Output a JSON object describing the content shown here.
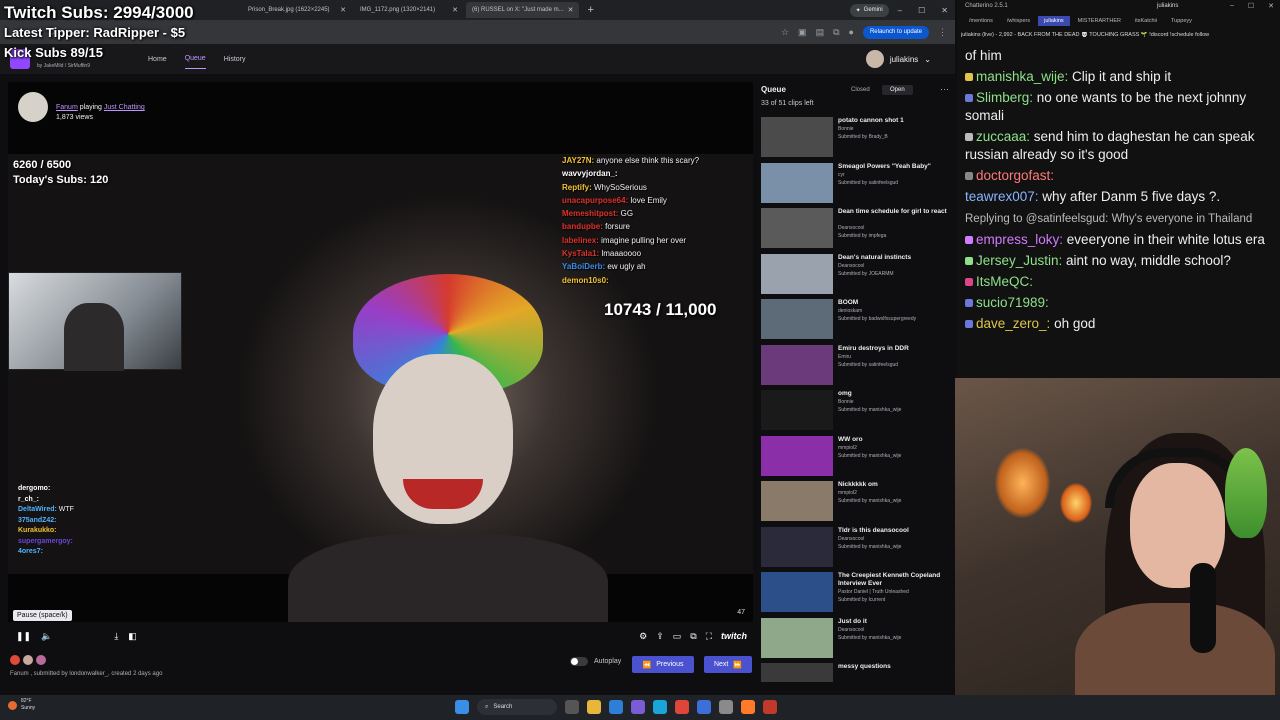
{
  "overlay": {
    "twitch_subs": "Twitch Subs: 2994/3000",
    "latest_tipper": "Latest Tipper: RadRipper - $5",
    "kick_subs": "Kick Subs 89/15"
  },
  "browser": {
    "tabs": [
      {
        "label": "Prison_Break.jpg (1622×2245)"
      },
      {
        "label": "IMG_1172.png (1320×2141)"
      },
      {
        "label": "(6) RUSSEL on X: \"Just made m..."
      }
    ],
    "new_tab": "+",
    "gemini": "Gemini",
    "relaunch": "Relaunch to update"
  },
  "site": {
    "byline_prefix": "by",
    "byline_users": "JakeMild / SirMuffin9",
    "nav": [
      "Home",
      "Queue",
      "History"
    ],
    "user": "juliakins"
  },
  "clip": {
    "channel": "Fanum",
    "playing": "playing",
    "category": "Just Chatting",
    "views": "1,873 views",
    "sub_goal": "6260 / 6500",
    "todays_subs": "Today's Subs: 120",
    "big_goal": "10743 / 11,000",
    "tooltip": "Pause (space/k)",
    "time": "47",
    "progress": 0.22,
    "chat": [
      {
        "user": "JAY27N",
        "color": "#f1c232",
        "text": "anyone else think this scary?"
      },
      {
        "user": "wavvyjordan_",
        "color": "#ffffff",
        "text": ""
      },
      {
        "user": "Reptify",
        "color": "#f1c232",
        "text": "WhySoSerious"
      },
      {
        "user": "unacapurpose64",
        "color": "#e0312b",
        "text": "love Emily"
      },
      {
        "user": "Memeshitpost",
        "color": "#e0312b",
        "text": "GG"
      },
      {
        "user": "bandupbe",
        "color": "#e0312b",
        "text": "forsure"
      },
      {
        "user": "labelinex",
        "color": "#e0312b",
        "text": "imagine pulling her over"
      },
      {
        "user": "KysTala1",
        "color": "#e0312b",
        "text": "lmaaaoooo"
      },
      {
        "user": "YaBoiDerb",
        "color": "#3c8ce7",
        "text": "ew ugly ah"
      },
      {
        "user": "demon10s0",
        "color": "#f1c232",
        "text": ""
      }
    ],
    "mini_chat": [
      {
        "user": "dergomo",
        "color": "#ffffff",
        "text": ""
      },
      {
        "user": "r_ch_",
        "color": "#ffffff",
        "text": ""
      },
      {
        "user": "DeltaWired",
        "color": "#4fb3ff",
        "text": "WTF"
      },
      {
        "user": "375andZ42",
        "color": "#4fb3ff",
        "text": ""
      },
      {
        "user": "Kurakukko",
        "color": "#f1c232",
        "text": ""
      },
      {
        "user": "supergamergoy",
        "color": "#6b46d9",
        "text": ""
      },
      {
        "user": "4ores7",
        "color": "#4fb3ff",
        "text": ""
      }
    ],
    "submitted_meta": "Fanum , submitted by londonwalker_, created 2 days ago",
    "autoplay": "Autoplay",
    "previous": "Previous",
    "next": "Next",
    "twitch_word": "twitch"
  },
  "queue": {
    "title": "Queue",
    "count": "33 of 51 clips left",
    "tab_closed": "Closed",
    "tab_open": "Open",
    "items": [
      {
        "title": "potato cannon shot 1",
        "channel": "Bonnie",
        "by": "Submitted by Brady_B",
        "thumb": "#4b4b4b"
      },
      {
        "title": "Smeagol Powers \"Yeah Baby\"",
        "channel": "cyr",
        "by": "Submitted by satinfeelsgud",
        "thumb": "#7a8fa8"
      },
      {
        "title": "Dean time schedule for girl to react",
        "channel": "Deansocool",
        "by": "Submitted by impfega",
        "thumb": "#5a5a5a"
      },
      {
        "title": "Dean's natural instincts",
        "channel": "Deansocool",
        "by": "Submitted by JOEARMM",
        "thumb": "#9aa3ad"
      },
      {
        "title": "BOOM",
        "channel": "denioskam",
        "by": "Submitted by badwolfxsupergreedy",
        "thumb": "#5d6b78"
      },
      {
        "title": "Emiru destroys in DDR",
        "channel": "Emiru",
        "by": "Submitted by satinfeelsgud",
        "thumb": "#6b3a7a"
      },
      {
        "title": "omg",
        "channel": "Bonnie",
        "by": "Submitted by manishka_wije",
        "thumb": "#1a1a1a"
      },
      {
        "title": "WW oro",
        "channel": "mmpiol2",
        "by": "Submitted by manishka_wije",
        "thumb": "#8a2fa8"
      },
      {
        "title": "Nickkkkk om",
        "channel": "mmpiol2",
        "by": "Submitted by manishka_wije",
        "thumb": "#8a7a6a"
      },
      {
        "title": "Tldr is this deansocool",
        "channel": "Deansocool",
        "by": "Submitted by manishka_wije",
        "thumb": "#2a2a3a"
      },
      {
        "title": "The Creepiest Kenneth Copeland Interview Ever",
        "channel": "Pastor Daniel | Truth Unleashed",
        "by": "Submitted by lcurrent",
        "thumb": "#2c4f8a"
      },
      {
        "title": "Just do it",
        "channel": "Deansocool",
        "by": "Submitted by manishka_wije",
        "thumb": "#8fa88a"
      },
      {
        "title": "messy questions",
        "channel": "",
        "by": "",
        "thumb": "#3a3a3a"
      }
    ]
  },
  "chatterino": {
    "title": "Chatterino 2.5.1",
    "user": "juliakins",
    "tabs": [
      "/mentions",
      "/whispers",
      "juliakins",
      "MISTERARTHER",
      "itsKatchii",
      "Tuppeyy"
    ],
    "status": "juliakins (live) - 2,992 - BACK FROM THE DEAD 💀 TOUCHING GRASS 🌱 !discord !schedule   follow",
    "messages": [
      {
        "user": "",
        "color": "#ffffff",
        "text": "of him",
        "badge": ""
      },
      {
        "user": "manishka_wije:",
        "color": "#8ee08a",
        "text": "Clip it and ship it",
        "badge": "#e0c54a"
      },
      {
        "user": "Slimberg:",
        "color": "#8ee08a",
        "text": "no one wants to be the next johnny somali",
        "badge": "#6b78d9"
      },
      {
        "user": "zuccaaa:",
        "color": "#8ee08a",
        "text": "send him to daghestan he can speak russian already so it's good",
        "badge": "#bbbbbb"
      },
      {
        "user": "doctorgofast:",
        "color": "#ff7a7a",
        "text": "",
        "badge": "#888888"
      },
      {
        "user": "teawrex007:",
        "color": "#8ab4ff",
        "text": "why after Danm 5 five days ?.",
        "badge": ""
      },
      {
        "user": "",
        "color": "#bbbbbb",
        "text": "",
        "badge": "",
        "reply": "Replying to @satinfeelsgud: Why's everyone in Thailand"
      },
      {
        "user": "empress_loky:",
        "color": "#d27bff",
        "text": "eveeryone in their white lotus era",
        "badge": "#d27bff"
      },
      {
        "user": "Jersey_Justin:",
        "color": "#8ee08a",
        "text": "aint no way, middle school?",
        "badge": "#8ee08a"
      },
      {
        "user": "ItsMeQC:",
        "color": "#8ee08a",
        "text": "",
        "badge": "#d9468a"
      },
      {
        "user": "sucio71989:",
        "color": "#8ee08a",
        "text": "",
        "badge": "#6b78d9"
      },
      {
        "user": "dave_zero_:",
        "color": "#e0c54a",
        "text": "oh god",
        "badge": "#6b78d9"
      }
    ]
  },
  "taskbar": {
    "temp": "82°F",
    "condition": "Sunny",
    "search": "Search"
  },
  "icons": [
    "back-icon",
    "forward-icon",
    "reload-icon",
    "star-icon",
    "menu-icon",
    "pause-icon",
    "volume-icon",
    "download-icon",
    "settings-icon",
    "fullscreen-icon",
    "windows-icon",
    "search-icon"
  ]
}
